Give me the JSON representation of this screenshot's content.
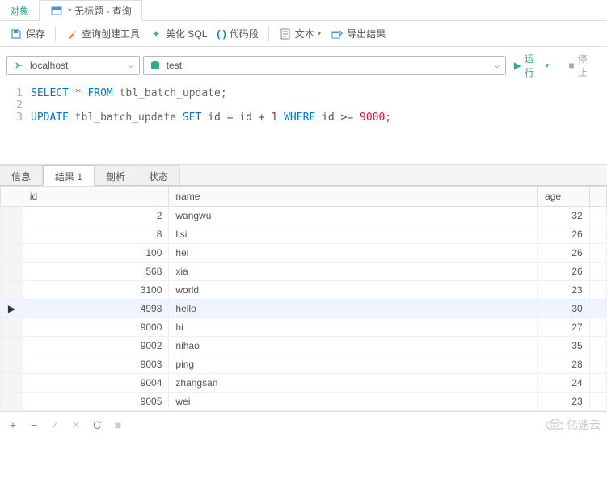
{
  "topTabs": {
    "objects": "对象",
    "queryTitle": "* 无标题 - 查询"
  },
  "toolbar": {
    "save": "保存",
    "queryBuilder": "查询创建工具",
    "beautifySql": "美化 SQL",
    "codeSnippet": "代码段",
    "text": "文本",
    "exportResult": "导出结果"
  },
  "connection": {
    "host": "localhost",
    "db": "test",
    "run": "运行",
    "stop": "停止"
  },
  "code": {
    "line1a": "SELECT",
    "line1b": " * ",
    "line1c": "FROM",
    "line1d": " tbl_batch_update;",
    "line3a": "UPDATE",
    "line3b": " tbl_batch_update ",
    "line3c": "SET",
    "line3d": " id = id + ",
    "line3e": "1",
    "line3f": " WHERE",
    "line3g": " id >= ",
    "line3h": "9000",
    "line3i": ";"
  },
  "resultTabs": {
    "info": "信息",
    "result": "结果 1",
    "profile": "剖析",
    "status": "状态"
  },
  "columns": {
    "id": "id",
    "name": "name",
    "age": "age"
  },
  "rows": [
    {
      "id": "2",
      "name": "wangwu",
      "age": "32"
    },
    {
      "id": "8",
      "name": "lisi",
      "age": "26"
    },
    {
      "id": "100",
      "name": "hei",
      "age": "26"
    },
    {
      "id": "568",
      "name": "xia",
      "age": "26"
    },
    {
      "id": "3100",
      "name": "world",
      "age": "23"
    },
    {
      "id": "4998",
      "name": "hello",
      "age": "30"
    },
    {
      "id": "9000",
      "name": "hi",
      "age": "27"
    },
    {
      "id": "9002",
      "name": "nihao",
      "age": "35"
    },
    {
      "id": "9003",
      "name": "ping",
      "age": "28"
    },
    {
      "id": "9004",
      "name": "zhangsan",
      "age": "24"
    },
    {
      "id": "9005",
      "name": "wei",
      "age": "23"
    }
  ],
  "watermark": "亿速云"
}
